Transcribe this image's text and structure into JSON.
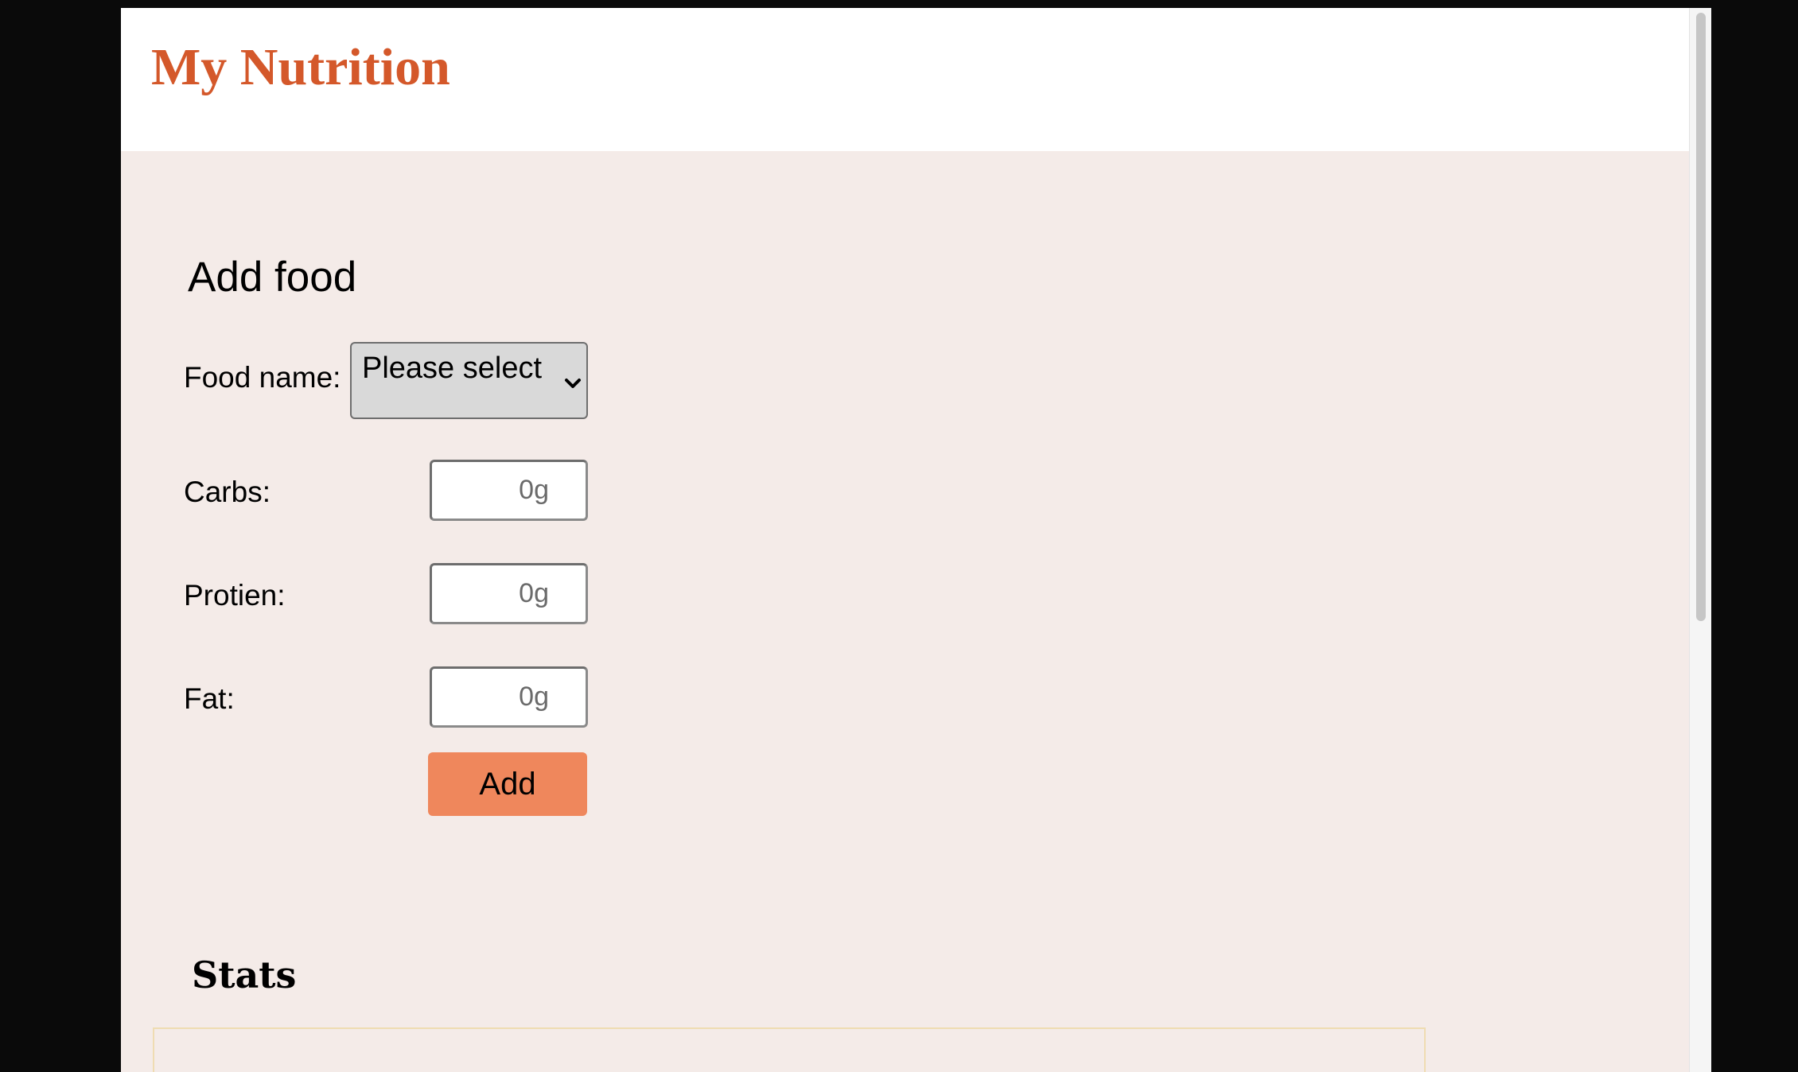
{
  "app": {
    "title": "My Nutrition",
    "brand_color": "#d4582a"
  },
  "add_food": {
    "heading": "Add food",
    "food_name_label": "Food name:",
    "food_select_value": "Please select",
    "carbs_label": "Carbs:",
    "carbs_placeholder": "0g",
    "protien_label": "Protien:",
    "protien_placeholder": "0g",
    "fat_label": "Fat:",
    "fat_placeholder": "0g",
    "add_button_label": "Add",
    "add_button_color": "#ef875c"
  },
  "stats": {
    "heading": "Stats"
  },
  "icons": {
    "select_chevron": "chevron-down-icon"
  }
}
